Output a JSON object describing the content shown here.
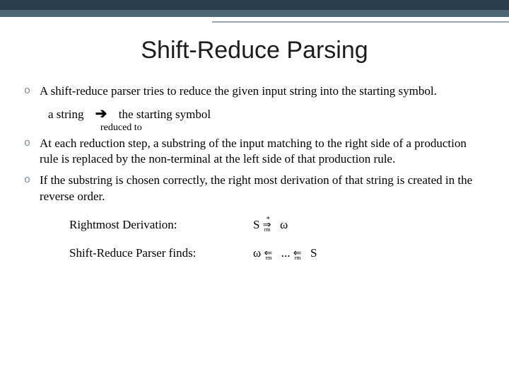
{
  "title": "Shift-Reduce Parsing",
  "bullets": {
    "b1": "A shift-reduce parser tries to reduce the given input string into the starting symbol.",
    "b2": "At each reduction step, a substring of the input matching to the right side of a production rule is replaced by the non-terminal at the left side of that production rule.",
    "b3": "If the substring is chosen correctly, the right most derivation of that string is created in the reverse order."
  },
  "reduce": {
    "left": "a string",
    "arrow": "➔",
    "right": "the starting symbol",
    "caption": "reduced to"
  },
  "deriv": {
    "row1_label": "Rightmost Derivation:",
    "row1_lhs": "S",
    "row1_rhs": "ω",
    "row2_label": "Shift-Reduce Parser finds:",
    "row2_lhs": "ω",
    "row2_mid": "...",
    "row2_rhs": "S",
    "star": "*",
    "rm": "rm",
    "right_arrow": "⇒",
    "left_arrow": "⇐"
  },
  "marker": "o"
}
